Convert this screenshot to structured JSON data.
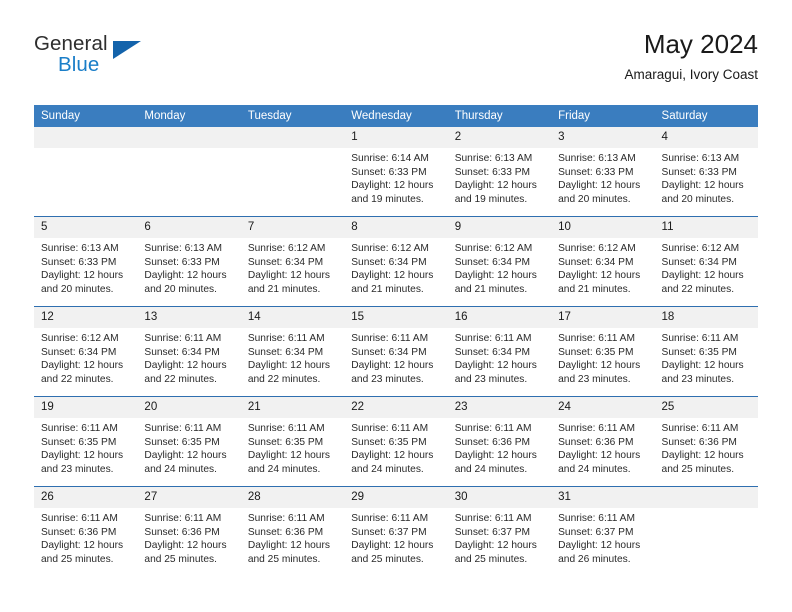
{
  "brand": {
    "line1": "General",
    "line2": "Blue",
    "accent_color": "#1a7ec8",
    "triangle_color": "#1363ab"
  },
  "header": {
    "title": "May 2024",
    "subtitle": "Amaragui, Ivory Coast"
  },
  "theme": {
    "header_bar": "#3a7dbf",
    "row_divider": "#2f6fb0",
    "daynum_band": "#f1f1f1",
    "page_background": "#ffffff"
  },
  "weekday_headers": [
    "Sunday",
    "Monday",
    "Tuesday",
    "Wednesday",
    "Thursday",
    "Friday",
    "Saturday"
  ],
  "labels": {
    "sunrise_prefix": "Sunrise:",
    "sunset_prefix": "Sunset:",
    "daylight_prefix": "Daylight:"
  },
  "weeks": [
    [
      {
        "day": "",
        "empty": true
      },
      {
        "day": "",
        "empty": true
      },
      {
        "day": "",
        "empty": true
      },
      {
        "day": "1",
        "sunrise": "Sunrise: 6:14 AM",
        "sunset": "Sunset: 6:33 PM",
        "daylight_1": "Daylight: 12 hours",
        "daylight_2": "and 19 minutes."
      },
      {
        "day": "2",
        "sunrise": "Sunrise: 6:13 AM",
        "sunset": "Sunset: 6:33 PM",
        "daylight_1": "Daylight: 12 hours",
        "daylight_2": "and 19 minutes."
      },
      {
        "day": "3",
        "sunrise": "Sunrise: 6:13 AM",
        "sunset": "Sunset: 6:33 PM",
        "daylight_1": "Daylight: 12 hours",
        "daylight_2": "and 20 minutes."
      },
      {
        "day": "4",
        "sunrise": "Sunrise: 6:13 AM",
        "sunset": "Sunset: 6:33 PM",
        "daylight_1": "Daylight: 12 hours",
        "daylight_2": "and 20 minutes."
      }
    ],
    [
      {
        "day": "5",
        "sunrise": "Sunrise: 6:13 AM",
        "sunset": "Sunset: 6:33 PM",
        "daylight_1": "Daylight: 12 hours",
        "daylight_2": "and 20 minutes."
      },
      {
        "day": "6",
        "sunrise": "Sunrise: 6:13 AM",
        "sunset": "Sunset: 6:33 PM",
        "daylight_1": "Daylight: 12 hours",
        "daylight_2": "and 20 minutes."
      },
      {
        "day": "7",
        "sunrise": "Sunrise: 6:12 AM",
        "sunset": "Sunset: 6:34 PM",
        "daylight_1": "Daylight: 12 hours",
        "daylight_2": "and 21 minutes."
      },
      {
        "day": "8",
        "sunrise": "Sunrise: 6:12 AM",
        "sunset": "Sunset: 6:34 PM",
        "daylight_1": "Daylight: 12 hours",
        "daylight_2": "and 21 minutes."
      },
      {
        "day": "9",
        "sunrise": "Sunrise: 6:12 AM",
        "sunset": "Sunset: 6:34 PM",
        "daylight_1": "Daylight: 12 hours",
        "daylight_2": "and 21 minutes."
      },
      {
        "day": "10",
        "sunrise": "Sunrise: 6:12 AM",
        "sunset": "Sunset: 6:34 PM",
        "daylight_1": "Daylight: 12 hours",
        "daylight_2": "and 21 minutes."
      },
      {
        "day": "11",
        "sunrise": "Sunrise: 6:12 AM",
        "sunset": "Sunset: 6:34 PM",
        "daylight_1": "Daylight: 12 hours",
        "daylight_2": "and 22 minutes."
      }
    ],
    [
      {
        "day": "12",
        "sunrise": "Sunrise: 6:12 AM",
        "sunset": "Sunset: 6:34 PM",
        "daylight_1": "Daylight: 12 hours",
        "daylight_2": "and 22 minutes."
      },
      {
        "day": "13",
        "sunrise": "Sunrise: 6:11 AM",
        "sunset": "Sunset: 6:34 PM",
        "daylight_1": "Daylight: 12 hours",
        "daylight_2": "and 22 minutes."
      },
      {
        "day": "14",
        "sunrise": "Sunrise: 6:11 AM",
        "sunset": "Sunset: 6:34 PM",
        "daylight_1": "Daylight: 12 hours",
        "daylight_2": "and 22 minutes."
      },
      {
        "day": "15",
        "sunrise": "Sunrise: 6:11 AM",
        "sunset": "Sunset: 6:34 PM",
        "daylight_1": "Daylight: 12 hours",
        "daylight_2": "and 23 minutes."
      },
      {
        "day": "16",
        "sunrise": "Sunrise: 6:11 AM",
        "sunset": "Sunset: 6:34 PM",
        "daylight_1": "Daylight: 12 hours",
        "daylight_2": "and 23 minutes."
      },
      {
        "day": "17",
        "sunrise": "Sunrise: 6:11 AM",
        "sunset": "Sunset: 6:35 PM",
        "daylight_1": "Daylight: 12 hours",
        "daylight_2": "and 23 minutes."
      },
      {
        "day": "18",
        "sunrise": "Sunrise: 6:11 AM",
        "sunset": "Sunset: 6:35 PM",
        "daylight_1": "Daylight: 12 hours",
        "daylight_2": "and 23 minutes."
      }
    ],
    [
      {
        "day": "19",
        "sunrise": "Sunrise: 6:11 AM",
        "sunset": "Sunset: 6:35 PM",
        "daylight_1": "Daylight: 12 hours",
        "daylight_2": "and 23 minutes."
      },
      {
        "day": "20",
        "sunrise": "Sunrise: 6:11 AM",
        "sunset": "Sunset: 6:35 PM",
        "daylight_1": "Daylight: 12 hours",
        "daylight_2": "and 24 minutes."
      },
      {
        "day": "21",
        "sunrise": "Sunrise: 6:11 AM",
        "sunset": "Sunset: 6:35 PM",
        "daylight_1": "Daylight: 12 hours",
        "daylight_2": "and 24 minutes."
      },
      {
        "day": "22",
        "sunrise": "Sunrise: 6:11 AM",
        "sunset": "Sunset: 6:35 PM",
        "daylight_1": "Daylight: 12 hours",
        "daylight_2": "and 24 minutes."
      },
      {
        "day": "23",
        "sunrise": "Sunrise: 6:11 AM",
        "sunset": "Sunset: 6:36 PM",
        "daylight_1": "Daylight: 12 hours",
        "daylight_2": "and 24 minutes."
      },
      {
        "day": "24",
        "sunrise": "Sunrise: 6:11 AM",
        "sunset": "Sunset: 6:36 PM",
        "daylight_1": "Daylight: 12 hours",
        "daylight_2": "and 24 minutes."
      },
      {
        "day": "25",
        "sunrise": "Sunrise: 6:11 AM",
        "sunset": "Sunset: 6:36 PM",
        "daylight_1": "Daylight: 12 hours",
        "daylight_2": "and 25 minutes."
      }
    ],
    [
      {
        "day": "26",
        "sunrise": "Sunrise: 6:11 AM",
        "sunset": "Sunset: 6:36 PM",
        "daylight_1": "Daylight: 12 hours",
        "daylight_2": "and 25 minutes."
      },
      {
        "day": "27",
        "sunrise": "Sunrise: 6:11 AM",
        "sunset": "Sunset: 6:36 PM",
        "daylight_1": "Daylight: 12 hours",
        "daylight_2": "and 25 minutes."
      },
      {
        "day": "28",
        "sunrise": "Sunrise: 6:11 AM",
        "sunset": "Sunset: 6:36 PM",
        "daylight_1": "Daylight: 12 hours",
        "daylight_2": "and 25 minutes."
      },
      {
        "day": "29",
        "sunrise": "Sunrise: 6:11 AM",
        "sunset": "Sunset: 6:37 PM",
        "daylight_1": "Daylight: 12 hours",
        "daylight_2": "and 25 minutes."
      },
      {
        "day": "30",
        "sunrise": "Sunrise: 6:11 AM",
        "sunset": "Sunset: 6:37 PM",
        "daylight_1": "Daylight: 12 hours",
        "daylight_2": "and 25 minutes."
      },
      {
        "day": "31",
        "sunrise": "Sunrise: 6:11 AM",
        "sunset": "Sunset: 6:37 PM",
        "daylight_1": "Daylight: 12 hours",
        "daylight_2": "and 26 minutes."
      },
      {
        "day": "",
        "empty": true
      }
    ]
  ]
}
